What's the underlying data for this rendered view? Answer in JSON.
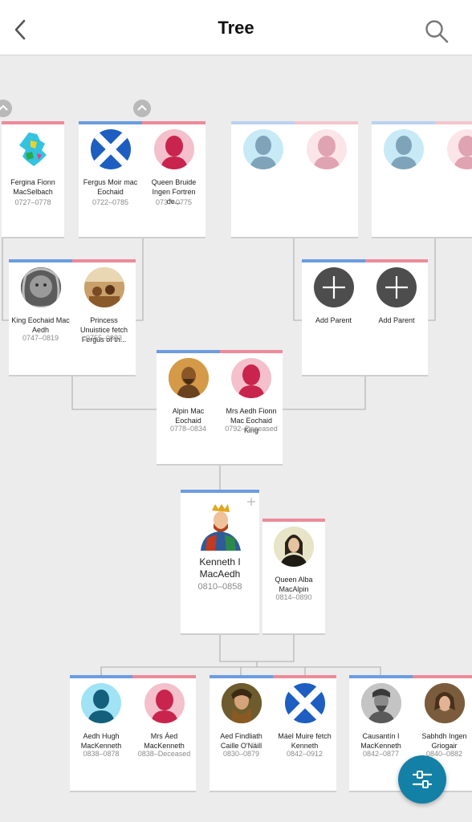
{
  "header": {
    "title": "Tree"
  },
  "gen1": [
    {
      "name": "Fergina Fionn MacSelbach",
      "dates": "0727–0778"
    },
    {
      "name": "Fergus Moir mac Eochaid",
      "dates": "0722–0785"
    },
    {
      "name": "Queen Bruide Ingen Fortren de...",
      "dates": "0737–0775"
    }
  ],
  "gen2": [
    {
      "name": "King Eochaid Mac Aedh",
      "dates": "0747–0819"
    },
    {
      "name": "Princess Unuistice fetch Fergus of th...",
      "dates": "0755–0803"
    },
    {
      "name": "Add Parent"
    },
    {
      "name": "Add Parent"
    }
  ],
  "gen3": [
    {
      "name": "Alpin Mac Eochaid",
      "dates": "0778–0834"
    },
    {
      "name": "Mrs Aedh Fionn Mac Eochaid King",
      "dates": "0792–Deceased"
    }
  ],
  "focus": {
    "name": "Kenneth I MacAedh",
    "dates": "0810–0858"
  },
  "spouse": {
    "name": "Queen Alba MacAlpin",
    "dates": "0814–0890"
  },
  "children": [
    {
      "name": "Aedh Hugh MacKenneth",
      "dates": "0838–0878"
    },
    {
      "name": "Mrs Áed MacKenneth",
      "dates": "0838–Deceased"
    },
    {
      "name": "Aed Findliath Caille O'Näill",
      "dates": "0830–0879"
    },
    {
      "name": "Máel Muire fetch Kenneth",
      "dates": "0842–0912"
    },
    {
      "name": "Causantín I MacKenneth",
      "dates": "0842–0877"
    },
    {
      "name": "Sabhdh Ingen Griogair",
      "dates": "0840–0882"
    }
  ]
}
